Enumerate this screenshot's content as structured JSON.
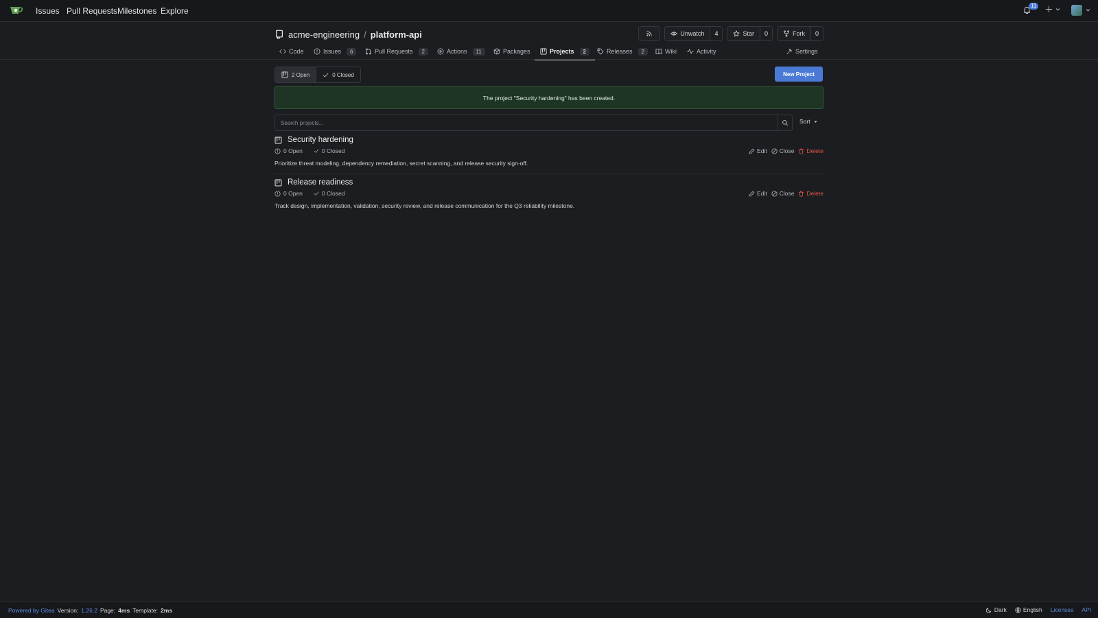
{
  "topnav": {
    "links": [
      "Issues",
      "Pull Requests",
      "Milestones",
      "Explore"
    ],
    "notification_count": "11"
  },
  "repo": {
    "owner": "acme-engineering",
    "separator": "/",
    "name": "platform-api",
    "unwatch_label": "Unwatch",
    "watch_count": "4",
    "star_label": "Star",
    "star_count": "0",
    "fork_label": "Fork",
    "fork_count": "0"
  },
  "tabs": {
    "code": "Code",
    "issues": "Issues",
    "issues_count": "6",
    "pulls": "Pull Requests",
    "pulls_count": "2",
    "actions": "Actions",
    "actions_count": "11",
    "packages": "Packages",
    "projects": "Projects",
    "projects_count": "2",
    "releases": "Releases",
    "releases_count": "2",
    "wiki": "Wiki",
    "activity": "Activity",
    "settings": "Settings"
  },
  "filters": {
    "open": "2 Open",
    "closed": "0 Closed"
  },
  "new_project_label": "New Project",
  "flash_message": "The project \"Security hardening\" has been created.",
  "search": {
    "placeholder": "Search projects...",
    "sort_label": "Sort"
  },
  "projects": [
    {
      "title": "Security hardening",
      "open": "0 Open",
      "closed": "0 Closed",
      "description": "Prioritize threat modeling, dependency remediation, secret scanning, and release security sign-off."
    },
    {
      "title": "Release readiness",
      "open": "0 Open",
      "closed": "0 Closed",
      "description": "Track design, implementation, validation, security review, and release communication for the Q3 reliability milestone."
    }
  ],
  "actions": {
    "edit": "Edit",
    "close": "Close",
    "delete": "Delete"
  },
  "footer": {
    "powered": "Powered by Gitea",
    "version_label": "Version:",
    "version": "1.26.2",
    "page_label": "Page:",
    "page_time": "4ms",
    "template_label": "Template:",
    "template_time": "2ms",
    "theme": "Dark",
    "language": "English",
    "licenses": "Licenses",
    "api": "API"
  },
  "colors": {
    "accent": "#4a7ad6",
    "danger": "#e5534b",
    "success_bg": "#1e3425"
  }
}
